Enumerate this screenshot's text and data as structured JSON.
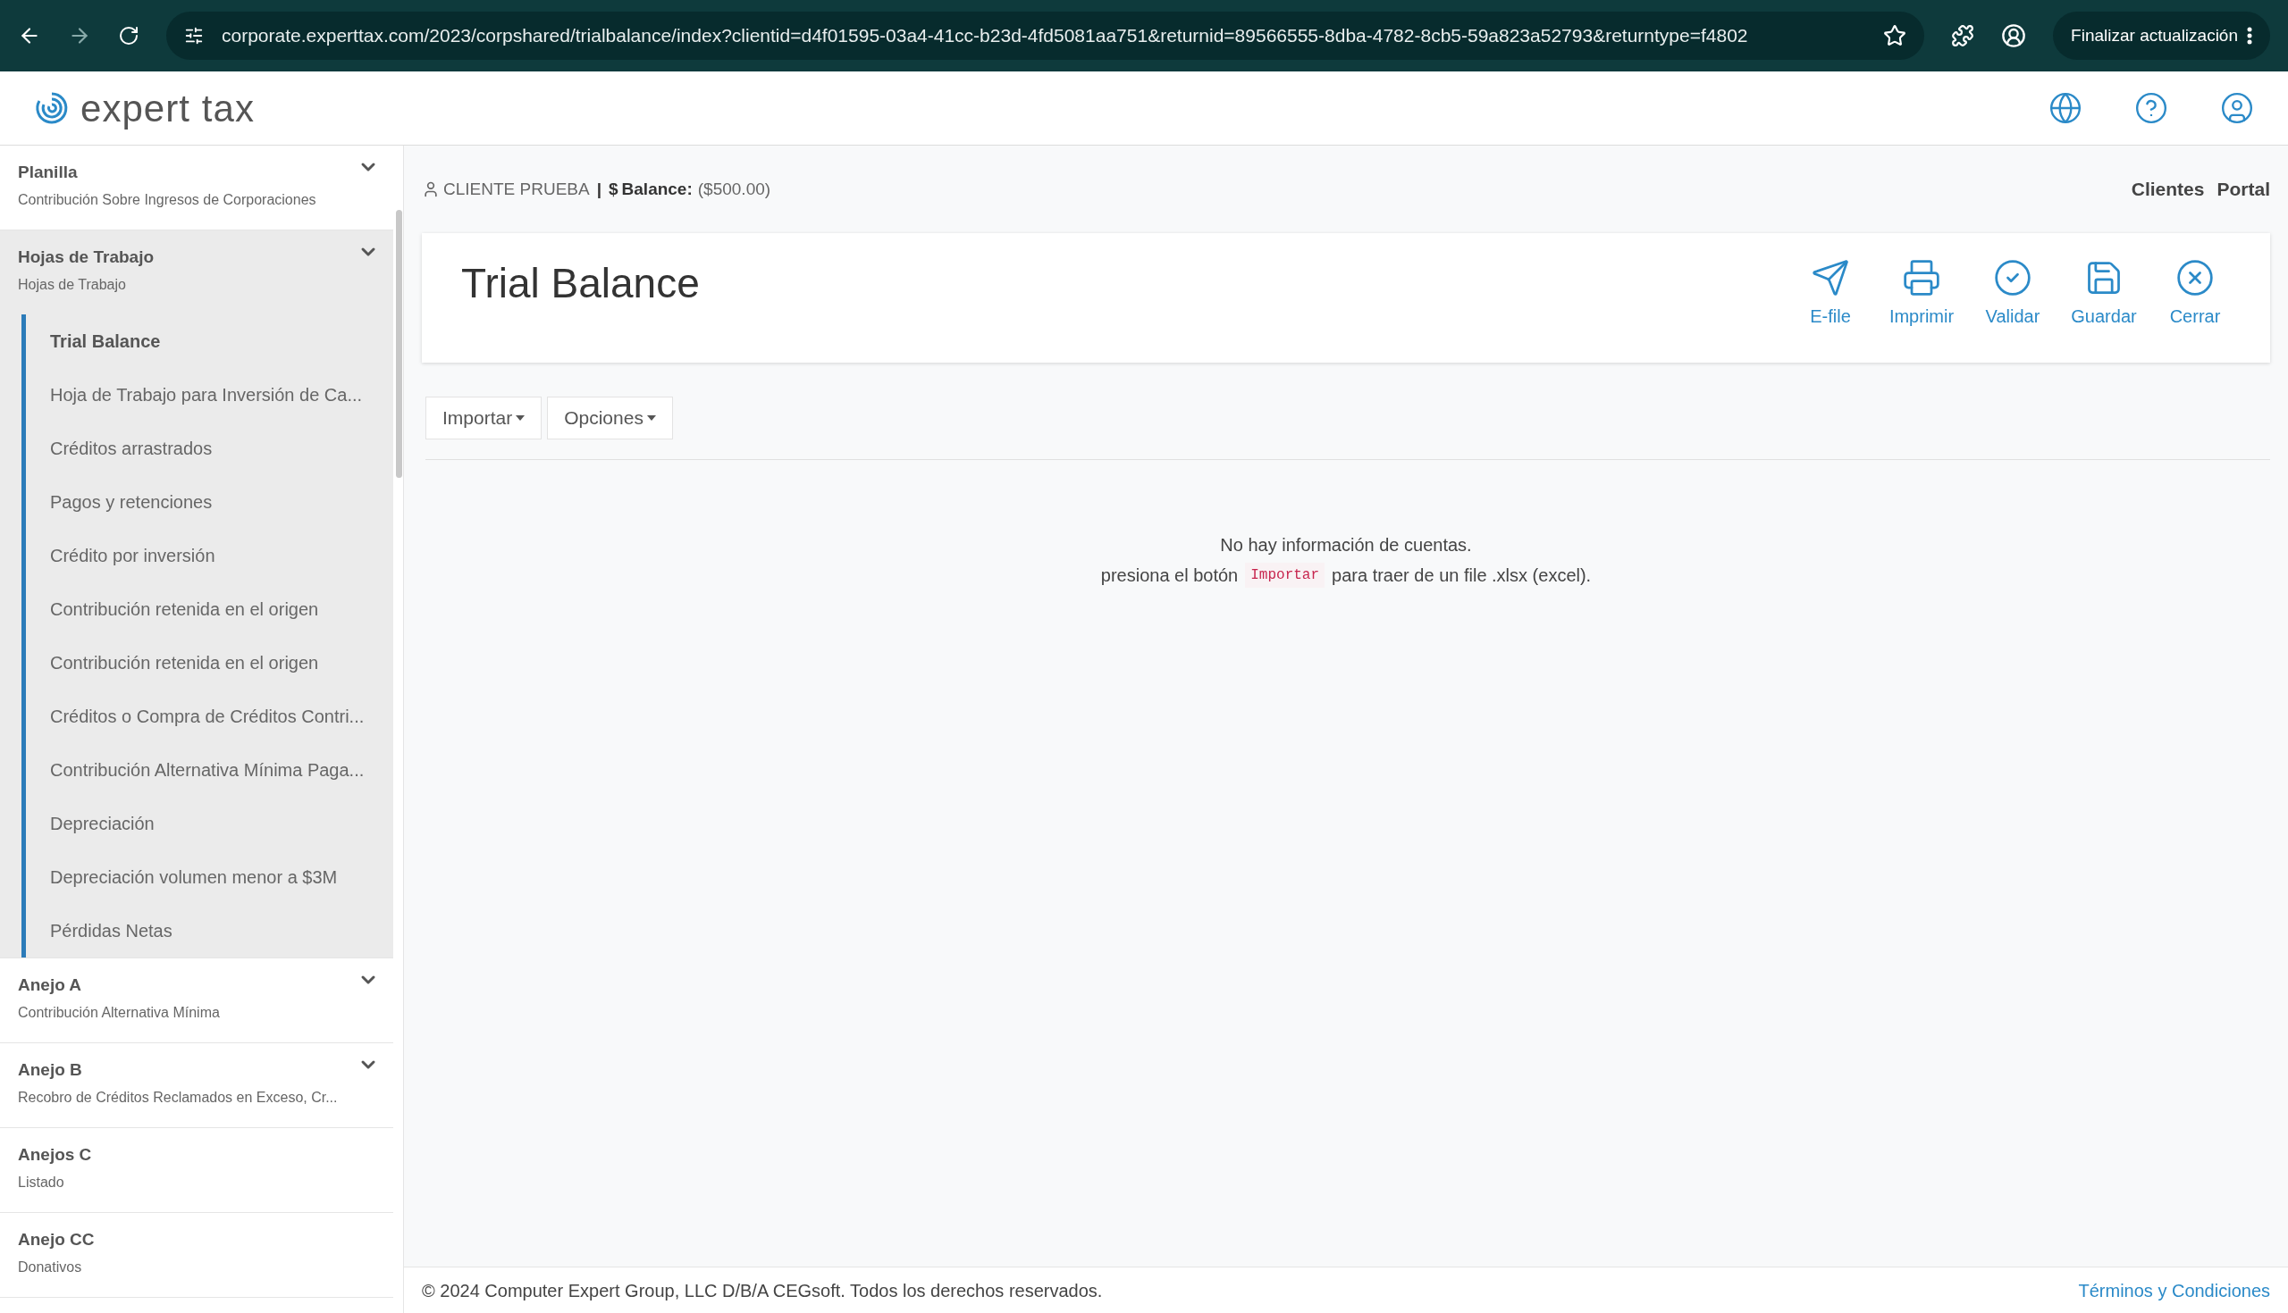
{
  "browser": {
    "url": "corporate.experttax.com/2023/corpshared/trialbalance/index?clientid=d4f01595-03a4-41cc-b23d-4fd5081aa751&returnid=89566555-8dba-4782-8cb5-59a823a52793&returntype=f4802",
    "update_button": "Finalizar actualización"
  },
  "header": {
    "logo": "expert tax"
  },
  "sidebar": {
    "groups": [
      {
        "title": "Planilla",
        "subtitle": "Contribución Sobre Ingresos de Corporaciones",
        "collapsible": true,
        "expanded": false
      },
      {
        "title": "Hojas de Trabajo",
        "subtitle": "Hojas de Trabajo",
        "collapsible": true,
        "expanded": true,
        "children": [
          {
            "label": "Trial Balance",
            "selected": true
          },
          {
            "label": "Hoja de Trabajo para Inversión de Ca...",
            "selected": false
          },
          {
            "label": "Créditos arrastrados",
            "selected": false
          },
          {
            "label": "Pagos y retenciones",
            "selected": false
          },
          {
            "label": "Crédito por inversión",
            "selected": false
          },
          {
            "label": "Contribución retenida en el origen",
            "selected": false
          },
          {
            "label": "Contribución retenida en el origen",
            "selected": false
          },
          {
            "label": "Créditos o Compra de Créditos Contri...",
            "selected": false
          },
          {
            "label": "Contribución Alternativa Mínima Paga...",
            "selected": false
          },
          {
            "label": "Depreciación",
            "selected": false
          },
          {
            "label": "Depreciación volumen menor a $3M",
            "selected": false
          },
          {
            "label": "Pérdidas Netas",
            "selected": false
          }
        ]
      },
      {
        "title": "Anejo A",
        "subtitle": "Contribución Alternativa Mínima",
        "collapsible": true,
        "expanded": false
      },
      {
        "title": "Anejo B",
        "subtitle": "Recobro de Créditos Reclamados en Exceso, Cr...",
        "collapsible": true,
        "expanded": false
      },
      {
        "title": "Anejos C",
        "subtitle": "Listado",
        "collapsible": false,
        "expanded": false
      },
      {
        "title": "Anejo CC",
        "subtitle": "Donativos",
        "collapsible": false,
        "expanded": false
      }
    ]
  },
  "context": {
    "client": "CLIENTE PRUEBA",
    "separator": "|",
    "currency": "$",
    "balance_label": "Balance:",
    "balance_value": "($500.00)",
    "links": [
      "Clientes",
      "Portal"
    ]
  },
  "page": {
    "title": "Trial Balance",
    "actions": [
      {
        "label": "E-file",
        "kind": "send"
      },
      {
        "label": "Imprimir",
        "kind": "print"
      },
      {
        "label": "Validar",
        "kind": "validate"
      },
      {
        "label": "Guardar",
        "kind": "save"
      },
      {
        "label": "Cerrar",
        "kind": "close"
      }
    ]
  },
  "toolbar": {
    "dropdowns": [
      "Importar",
      "Opciones"
    ]
  },
  "empty_state": {
    "line_1": "No hay información de cuentas.",
    "line_2_before": "presiona el botón",
    "line_2_code": "Importar",
    "line_2_after": "para traer de un file .xlsx (excel)."
  },
  "footer": {
    "copyright": "© 2024 Computer Expert Group, LLC D/B/A CEGsoft. Todos los derechos reservados.",
    "link": "Términos y Condiciones"
  }
}
